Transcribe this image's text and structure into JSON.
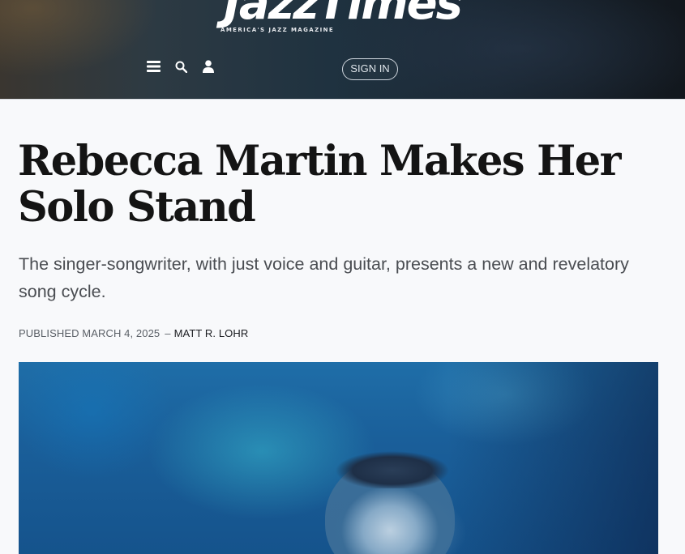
{
  "header": {
    "logo_text": "JazzTimes",
    "tagline": "AMERICA'S JAZZ MAGAZINE",
    "icons": [
      "menu-icon",
      "search-icon",
      "user-icon"
    ],
    "signin_label": "SIGN IN"
  },
  "article": {
    "headline": "Rebecca Martin Makes Her Solo Stand",
    "dek": "The singer-songwriter, with just voice and guitar, presents a new and revelatory song cycle.",
    "published_label": "PUBLISHED MARCH 4, 2025",
    "separator": "–",
    "author": "MATT R. LOHR"
  },
  "colors": {
    "headline": "#141414",
    "dek": "#4a4d52",
    "byline": "#5a5f66",
    "page_background": "#f8f9fb"
  }
}
